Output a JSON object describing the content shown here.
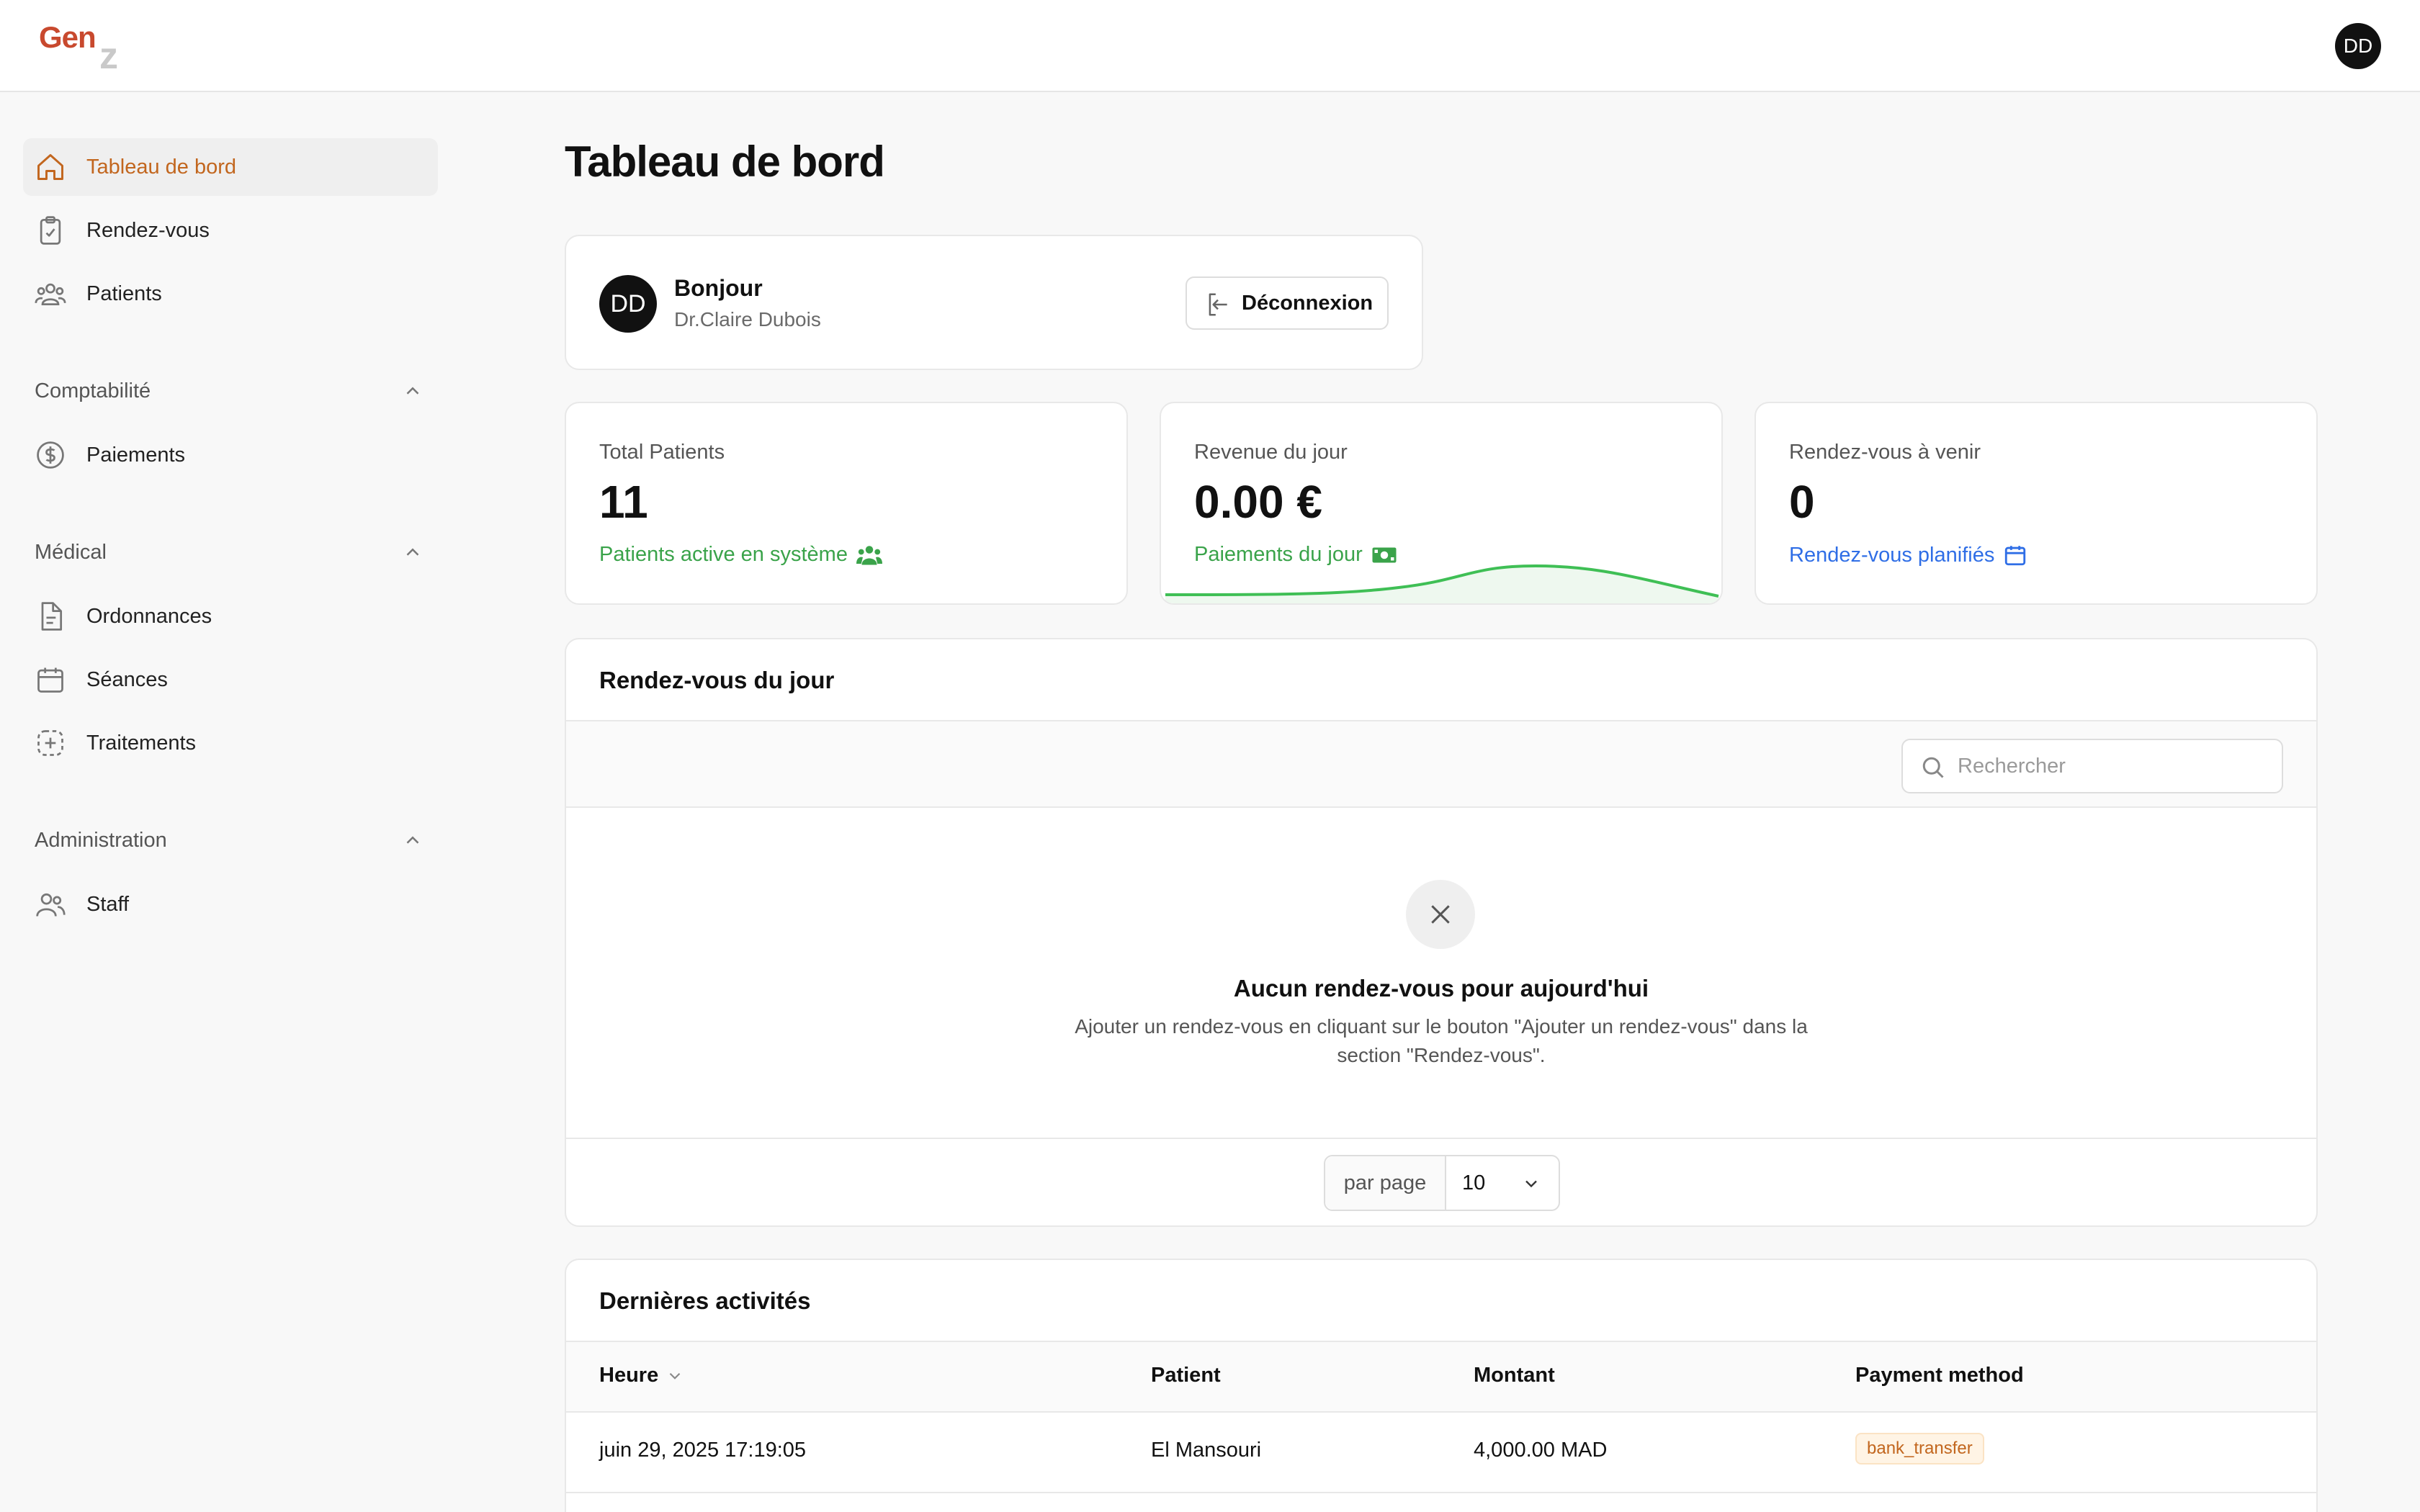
{
  "app": {
    "logo_text": "Gen",
    "logo_mark": "z",
    "user_initials": "DD"
  },
  "sidebar": {
    "items": [
      {
        "label": "Tableau de bord",
        "icon": "home-icon"
      },
      {
        "label": "Rendez-vous",
        "icon": "clipboard-check-icon"
      },
      {
        "label": "Patients",
        "icon": "users-icon"
      }
    ],
    "sections": [
      {
        "label": "Comptabilité",
        "items": [
          {
            "label": "Paiements",
            "icon": "dollar-circle-icon"
          }
        ]
      },
      {
        "label": "Médical",
        "items": [
          {
            "label": "Ordonnances",
            "icon": "document-icon"
          },
          {
            "label": "Séances",
            "icon": "calendar-icon"
          },
          {
            "label": "Traitements",
            "icon": "treatment-icon"
          }
        ]
      },
      {
        "label": "Administration",
        "items": [
          {
            "label": "Staff",
            "icon": "staff-icon"
          }
        ]
      }
    ]
  },
  "main": {
    "title": "Tableau de bord",
    "user_card": {
      "initials": "DD",
      "greeting": "Bonjour",
      "name": "Dr.Claire Dubois",
      "logout_label": "Déconnexion"
    },
    "stats": [
      {
        "title": "Total Patients",
        "value": "11",
        "subtitle": "Patients active en système",
        "color": "#3aa34a",
        "icon": "users-icon"
      },
      {
        "title": "Revenue du jour",
        "value": "0.00 €",
        "subtitle": "Paiements du jour",
        "color": "#3aa34a",
        "icon": "money-icon"
      },
      {
        "title": "Rendez-vous à venir",
        "value": "0",
        "subtitle": "Rendez-vous planifiés",
        "color": "#2f6ee6",
        "icon": "calendar-icon"
      }
    ],
    "appointments": {
      "title": "Rendez-vous du jour",
      "search_placeholder": "Rechercher",
      "empty_title": "Aucun rendez-vous pour aujourd'hui",
      "empty_description": "Ajouter un rendez-vous en cliquant sur le bouton \"Ajouter un rendez-vous\" dans la section \"Rendez-vous\".",
      "per_page_label": "par page",
      "per_page_value": "10"
    },
    "activities": {
      "title": "Dernières activités",
      "columns": [
        "Heure",
        "Patient",
        "Montant",
        "Payment method"
      ],
      "rows": [
        {
          "time": "juin 29, 2025 17:19:05",
          "patient": "El Mansouri",
          "amount": "4,000.00 MAD",
          "method": "bank_transfer"
        }
      ]
    }
  },
  "colors": {
    "accent": "#c2661e",
    "brand": "#c8492e",
    "green": "#3aa34a",
    "blue": "#2f6ee6"
  }
}
